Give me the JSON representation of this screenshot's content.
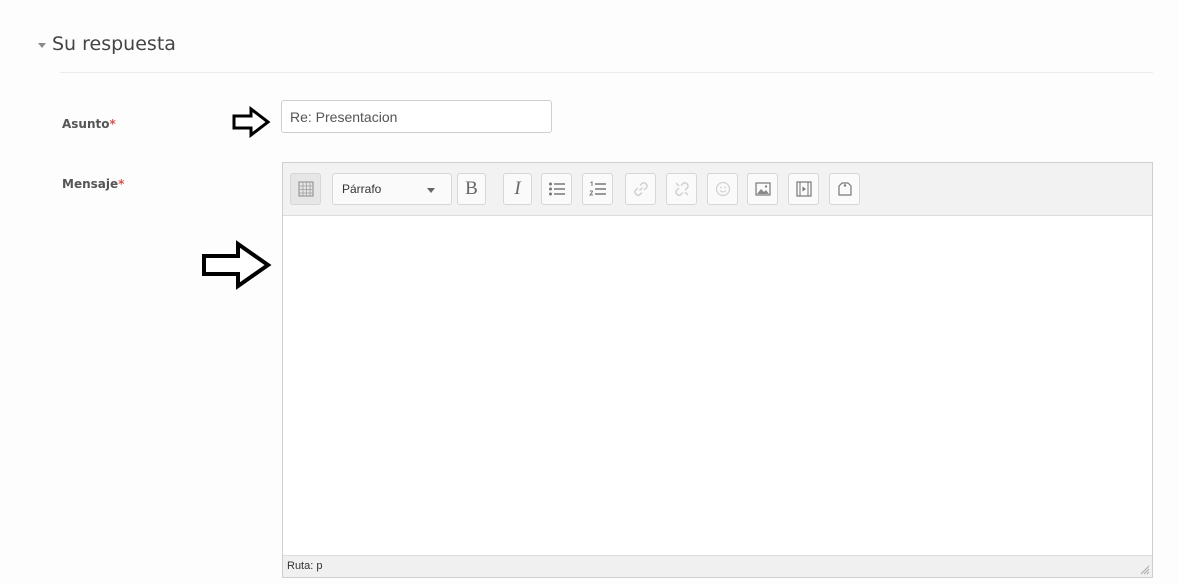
{
  "section": {
    "title": "Su respuesta"
  },
  "subject": {
    "label": "Asunto",
    "required_marker": "*",
    "value": "Re: Presentacion"
  },
  "message": {
    "label": "Mensaje",
    "required_marker": "*",
    "toolbar": {
      "toggle_icon": "toolbar-toggle-icon",
      "format_select": "Párrafo",
      "bold_label": "B",
      "italic_label": "I",
      "buttons": [
        "bullet-list-icon",
        "numbered-list-icon",
        "link-icon",
        "unlink-icon",
        "emoticon-icon",
        "image-icon",
        "media-icon",
        "manage-files-icon"
      ]
    },
    "content": "",
    "status_path": "Ruta: p"
  },
  "colors": {
    "required": "#d9534f",
    "toolbar_bg": "#f2f2f2",
    "border": "#cfcfcf"
  },
  "annotations": [
    "arrow-right-icon",
    "arrow-right-icon"
  ]
}
